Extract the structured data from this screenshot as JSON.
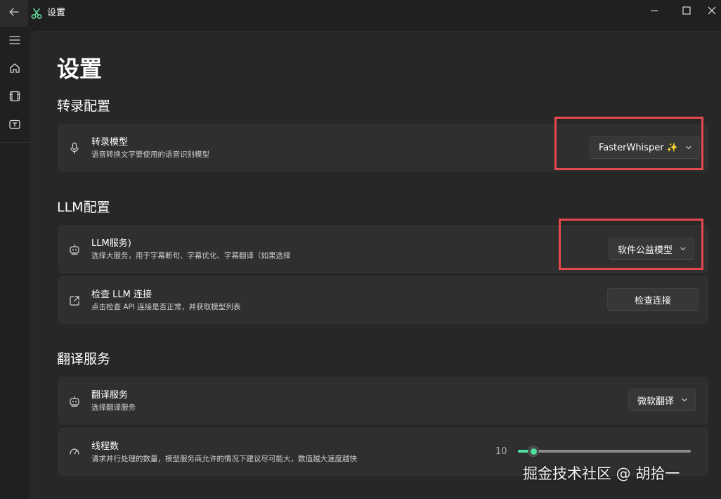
{
  "window": {
    "title": "设置",
    "controls": [
      "minimize",
      "maximize",
      "close"
    ]
  },
  "nav": {
    "items": [
      {
        "icon": "menu-icon"
      },
      {
        "icon": "home-icon"
      },
      {
        "icon": "video-icon"
      },
      {
        "icon": "subtitle-icon"
      }
    ]
  },
  "page": {
    "title": "设置"
  },
  "sections": {
    "transcription": {
      "title": "转录配置",
      "model": {
        "title": "转录模型",
        "description": "语音转换文字要使用的语音识别模型",
        "value": "FasterWhisper",
        "badge": "✨"
      }
    },
    "llm": {
      "title": "LLM配置",
      "service": {
        "title": "LLM服务)",
        "description": "选择大服务，用于字幕断句、字幕优化、字幕翻译（如果选择",
        "value": "软件公益模型"
      },
      "check": {
        "title": "检查 LLM 连接",
        "description": "点击检查 API 连接是否正常，并获取模型列表",
        "button": "检查连接"
      }
    },
    "translation": {
      "title": "翻译服务",
      "service": {
        "title": "翻译服务",
        "description": "选择翻译服务",
        "value": "微软翻译"
      },
      "threads": {
        "title": "线程数",
        "description": "请求并行处理的数量，模型服务商允许的情况下建议尽可能大，数值越大速度越快",
        "value": "10",
        "fraction": 0.09
      }
    }
  },
  "watermark": "掘金技术社区 @ 胡拾一",
  "colors": {
    "accent": "#4fe0a0",
    "highlight": "#e5484d",
    "background": "#202020",
    "card": "#2f2f2f"
  }
}
